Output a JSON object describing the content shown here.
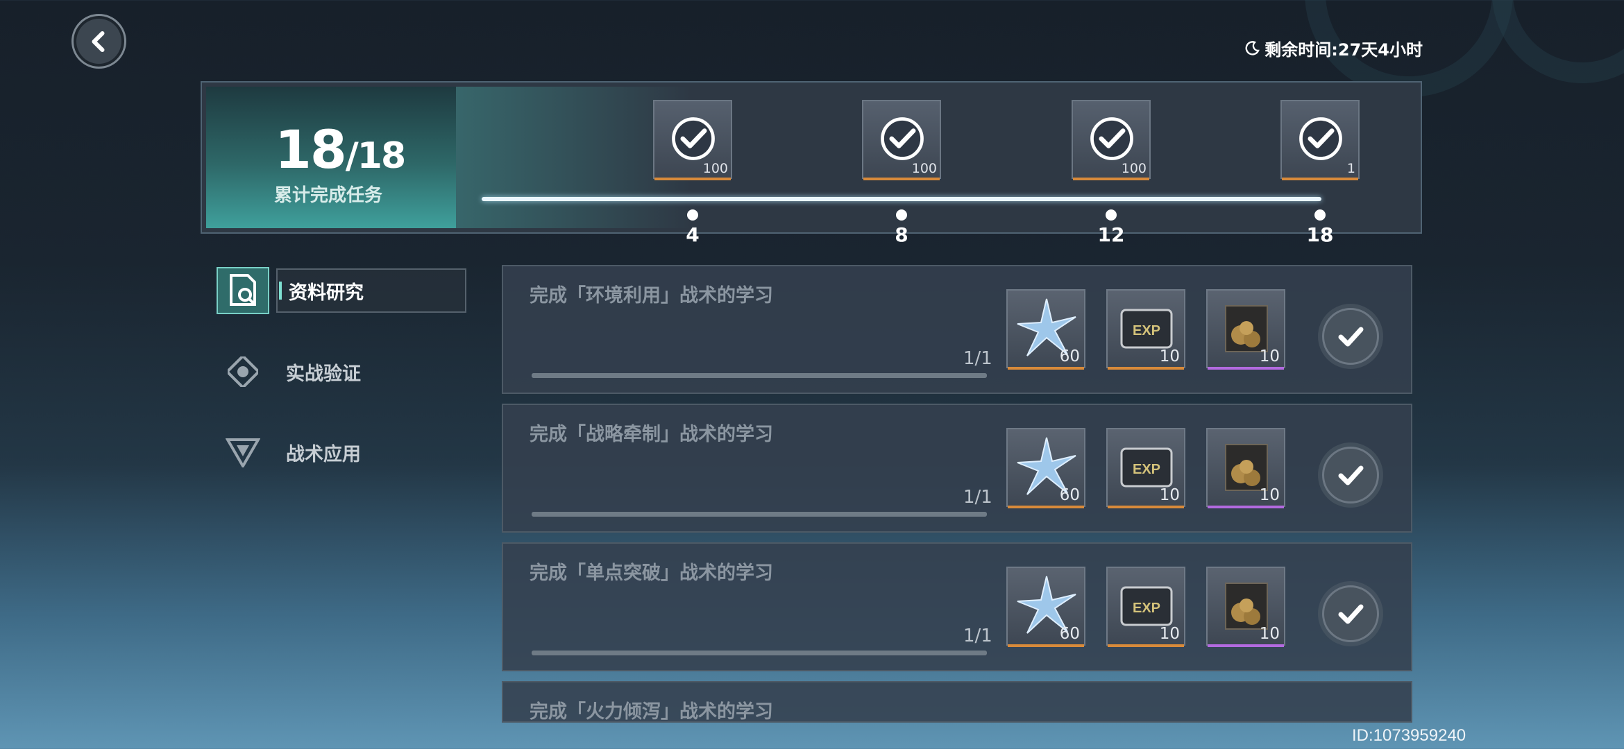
{
  "header": {
    "remaining_label": "剩余时间:27天4小时"
  },
  "summary": {
    "done": "18",
    "total": "/18",
    "label": "累计完成任务",
    "milestones": [
      {
        "threshold": "4",
        "qty": "100",
        "claimed": true
      },
      {
        "threshold": "8",
        "qty": "100",
        "claimed": true
      },
      {
        "threshold": "12",
        "qty": "100",
        "claimed": true
      },
      {
        "threshold": "18",
        "qty": "1",
        "claimed": true
      }
    ]
  },
  "categories": [
    {
      "label": "资料研究",
      "icon": "document-search-icon",
      "active": true
    },
    {
      "label": "实战验证",
      "icon": "target-gear-icon",
      "active": false
    },
    {
      "label": "战术应用",
      "icon": "triangle-emblem-icon",
      "active": false
    }
  ],
  "tasks": [
    {
      "title": "完成「环境利用」战术的学习",
      "count": "1/1",
      "progress": 1.0,
      "rewards": [
        {
          "name": "crystal-icon",
          "qty": "60",
          "tier": "orange"
        },
        {
          "name": "exp-card-icon",
          "qty": "10",
          "tier": "orange"
        },
        {
          "name": "gold-chest-icon",
          "qty": "10",
          "tier": "purple"
        }
      ]
    },
    {
      "title": "完成「战略牵制」战术的学习",
      "count": "1/1",
      "progress": 1.0,
      "rewards": [
        {
          "name": "crystal-icon",
          "qty": "60",
          "tier": "orange"
        },
        {
          "name": "exp-card-icon",
          "qty": "10",
          "tier": "orange"
        },
        {
          "name": "gold-chest-icon",
          "qty": "10",
          "tier": "purple"
        }
      ]
    },
    {
      "title": "完成「单点突破」战术的学习",
      "count": "1/1",
      "progress": 1.0,
      "rewards": [
        {
          "name": "crystal-icon",
          "qty": "60",
          "tier": "orange"
        },
        {
          "name": "exp-card-icon",
          "qty": "10",
          "tier": "orange"
        },
        {
          "name": "gold-chest-icon",
          "qty": "10",
          "tier": "purple"
        }
      ]
    },
    {
      "title": "完成「火力倾泻」战术的学习"
    }
  ],
  "footer": {
    "user_id": "ID:1073959240"
  }
}
